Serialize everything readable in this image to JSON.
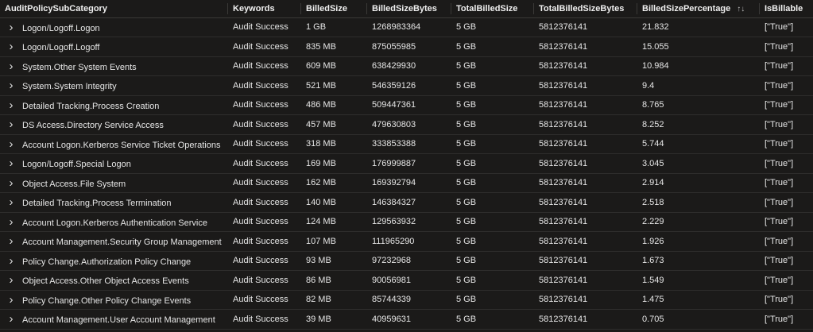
{
  "columns": [
    "AuditPolicySubCategory",
    "Keywords",
    "BilledSize",
    "BilledSizeBytes",
    "TotalBilledSize",
    "TotalBilledSizeBytes",
    "BilledSizePercentage",
    "IsBillable"
  ],
  "sort_icon": "sort-arrows-icon",
  "rows": [
    [
      "Logon/Logoff.Logon",
      "Audit Success",
      "1 GB",
      "1268983364",
      "5 GB",
      "5812376141",
      "21.832",
      "[\"True\"]"
    ],
    [
      "Logon/Logoff.Logoff",
      "Audit Success",
      "835 MB",
      "875055985",
      "5 GB",
      "5812376141",
      "15.055",
      "[\"True\"]"
    ],
    [
      "System.Other System Events",
      "Audit Success",
      "609 MB",
      "638429930",
      "5 GB",
      "5812376141",
      "10.984",
      "[\"True\"]"
    ],
    [
      "System.System Integrity",
      "Audit Success",
      "521 MB",
      "546359126",
      "5 GB",
      "5812376141",
      "9.4",
      "[\"True\"]"
    ],
    [
      "Detailed Tracking.Process Creation",
      "Audit Success",
      "486 MB",
      "509447361",
      "5 GB",
      "5812376141",
      "8.765",
      "[\"True\"]"
    ],
    [
      "DS Access.Directory Service Access",
      "Audit Success",
      "457 MB",
      "479630803",
      "5 GB",
      "5812376141",
      "8.252",
      "[\"True\"]"
    ],
    [
      "Account Logon.Kerberos Service Ticket Operations",
      "Audit Success",
      "318 MB",
      "333853388",
      "5 GB",
      "5812376141",
      "5.744",
      "[\"True\"]"
    ],
    [
      "Logon/Logoff.Special Logon",
      "Audit Success",
      "169 MB",
      "176999887",
      "5 GB",
      "5812376141",
      "3.045",
      "[\"True\"]"
    ],
    [
      "Object Access.File System",
      "Audit Success",
      "162 MB",
      "169392794",
      "5 GB",
      "5812376141",
      "2.914",
      "[\"True\"]"
    ],
    [
      "Detailed Tracking.Process Termination",
      "Audit Success",
      "140 MB",
      "146384327",
      "5 GB",
      "5812376141",
      "2.518",
      "[\"True\"]"
    ],
    [
      "Account Logon.Kerberos Authentication Service",
      "Audit Success",
      "124 MB",
      "129563932",
      "5 GB",
      "5812376141",
      "2.229",
      "[\"True\"]"
    ],
    [
      "Account Management.Security Group Management",
      "Audit Success",
      "107 MB",
      "111965290",
      "5 GB",
      "5812376141",
      "1.926",
      "[\"True\"]"
    ],
    [
      "Policy Change.Authorization Policy Change",
      "Audit Success",
      "93 MB",
      "97232968",
      "5 GB",
      "5812376141",
      "1.673",
      "[\"True\"]"
    ],
    [
      "Object Access.Other Object Access Events",
      "Audit Success",
      "86 MB",
      "90056981",
      "5 GB",
      "5812376141",
      "1.549",
      "[\"True\"]"
    ],
    [
      "Policy Change.Other Policy Change Events",
      "Audit Success",
      "82 MB",
      "85744339",
      "5 GB",
      "5812376141",
      "1.475",
      "[\"True\"]"
    ],
    [
      "Account Management.User Account Management",
      "Audit Success",
      "39 MB",
      "40959631",
      "5 GB",
      "5812376141",
      "0.705",
      "[\"True\"]"
    ]
  ]
}
